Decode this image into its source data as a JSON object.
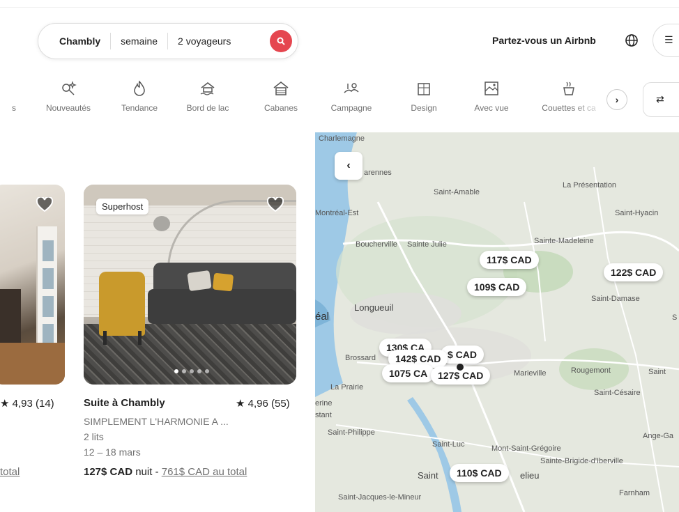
{
  "header": {
    "search": {
      "location": "Chambly",
      "dates": "semaine",
      "guests": "2 voyageurs"
    },
    "host_link": "Partez-vous un Airbnb"
  },
  "categories": [
    {
      "label": "s",
      "icon": "partial-icon"
    },
    {
      "label": "Nouveautés",
      "icon": "key-sparkle-icon"
    },
    {
      "label": "Tendance",
      "icon": "flame-icon"
    },
    {
      "label": "Bord de lac",
      "icon": "lake-house-icon"
    },
    {
      "label": "Cabanes",
      "icon": "cabin-icon"
    },
    {
      "label": "Campagne",
      "icon": "countryside-icon"
    },
    {
      "label": "Design",
      "icon": "design-building-icon"
    },
    {
      "label": "Avec vue",
      "icon": "view-icon"
    },
    {
      "label": "Couettes et ca",
      "icon": "breakfast-icon"
    }
  ],
  "listings": [
    {
      "rating": "4,93 (14)",
      "total": "total"
    },
    {
      "badge": "Superhost",
      "title": "Suite à Chambly",
      "rating": "4,96 (55)",
      "subtitle": "SIMPLEMENT L'HARMONIE A ...",
      "beds": "2 lits",
      "dates": "12 – 18 mars",
      "price": "127$ CAD",
      "price_suffix": "nuit -",
      "total": "761$ CAD au total"
    }
  ],
  "map": {
    "labels": [
      "Charlemagne",
      "arennes",
      "Saint-Amable",
      "La Présentation",
      "Montréal-Est",
      "Saint-Hyacin",
      "Boucherville",
      "Sainte Julie",
      "Sainte-Madeleine",
      "Saint-Damase",
      "éal",
      "Longueuil",
      "S",
      "Brossard",
      "Marieville",
      "Rougemont",
      "Saint",
      "La Prairie",
      "Saint-Césaire",
      "erine",
      "stant",
      "Saint-Philippe",
      "Saint-Luc",
      "Mont-Saint-Grégoire",
      "Ange-Ga",
      "Sainte-Brigide-d'Iberville",
      "Saint",
      "elieu",
      "Saint-Jacques-le-Mineur",
      "Farnham"
    ],
    "prices": [
      "117$ CAD",
      "109$ CAD",
      "122$ CAD",
      "130$ CA",
      "$ CAD",
      "142$ CAD",
      "1075 CA",
      "127$ CAD",
      "110$ CAD"
    ]
  }
}
